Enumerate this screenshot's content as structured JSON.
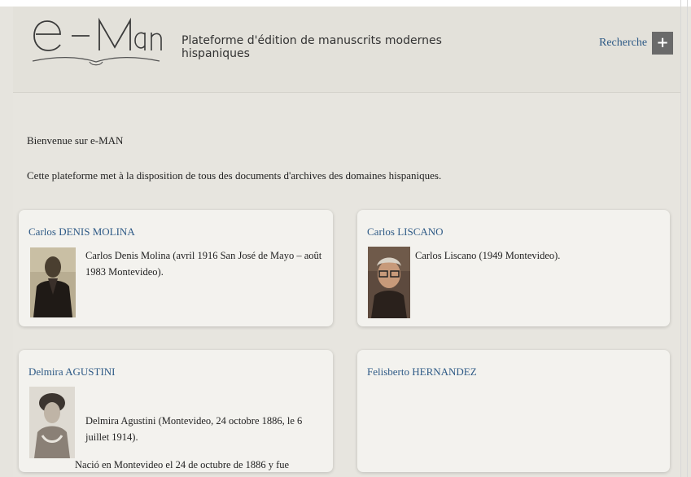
{
  "app": {
    "logo_text": "e-Man",
    "subtitle": "Plateforme d'édition de manuscrits modernes hispaniques",
    "search_label": "Recherche",
    "plus_icon": "plus-icon"
  },
  "main": {
    "welcome": "Bienvenue sur e-MAN",
    "intro": "Cette plateforme met à la disposition de tous des documents d'archives des domaines hispaniques."
  },
  "cards": [
    {
      "title": "Carlos DENIS MOLINA",
      "text": "Carlos Denis Molina (avril 1916 San José de Mayo – août 1983 Montevideo).",
      "text2": ""
    },
    {
      "title": "Carlos LISCANO",
      "text": "Carlos Liscano (1949 Montevideo).",
      "text2": ""
    },
    {
      "title": "Delmira AGUSTINI",
      "text": "Delmira Agustini (Montevideo, 24 octobre 1886, le 6 juillet 1914).",
      "text2": "Nació en Montevideo el 24 de octubre de 1886 y fue"
    },
    {
      "title": "Felisberto HERNANDEZ",
      "text": "",
      "text2": ""
    }
  ]
}
